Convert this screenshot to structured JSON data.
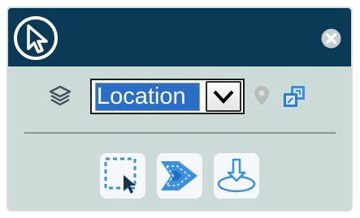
{
  "header": {
    "logo_icon": "pointer-arrow-circle-icon",
    "close_icon": "close-circle-icon"
  },
  "layer_select": {
    "icon": "layers-stack-icon",
    "selected_value": "Location",
    "dropdown_icon": "chevron-down-icon"
  },
  "actions": {
    "pin_icon": "map-pin-icon",
    "zoom_icon": "zoom-to-extent-icon"
  },
  "tools": [
    {
      "name": "select-by-rectangle",
      "icon": "dashed-rectangle-cursor-icon"
    },
    {
      "name": "buffer",
      "icon": "buffer-chevron-icon"
    },
    {
      "name": "extract-download",
      "icon": "download-arrow-plane-icon"
    }
  ],
  "colors": {
    "header_bg": "#0b3a56",
    "panel_bg": "#ccdbd8",
    "accent": "#2a6ec8",
    "icon_blue": "#3a8fe0"
  }
}
